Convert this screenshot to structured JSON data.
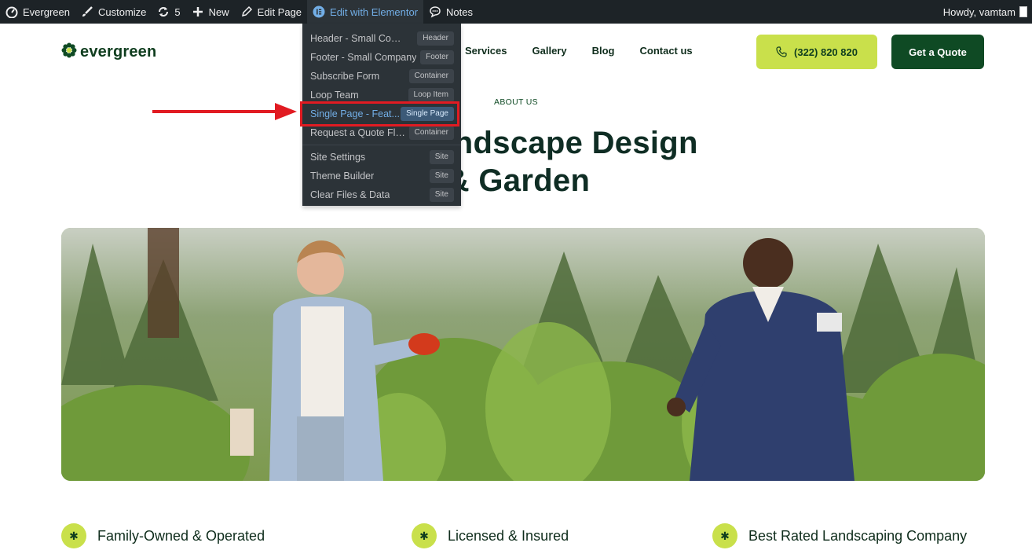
{
  "adminbar": {
    "site_name": "Evergreen",
    "customize": "Customize",
    "updates_count": "5",
    "new": "New",
    "edit_page": "Edit Page",
    "edit_with_elementor": "Edit with Elementor",
    "notes": "Notes",
    "greeting": "Howdy, vamtam"
  },
  "dropdown": {
    "items": [
      {
        "label": "Header - Small Comp...",
        "tag": "Header"
      },
      {
        "label": "Footer - Small Company",
        "tag": "Footer"
      },
      {
        "label": "Subscribe Form",
        "tag": "Container"
      },
      {
        "label": "Loop Team",
        "tag": "Loop Item"
      },
      {
        "label": "Single Page - Feat...",
        "tag": "Single Page"
      },
      {
        "label": "Request a Quote Flo...",
        "tag": "Container"
      }
    ],
    "site_items": [
      {
        "label": "Site Settings",
        "tag": "Site"
      },
      {
        "label": "Theme Builder",
        "tag": "Site"
      },
      {
        "label": "Clear Files & Data",
        "tag": "Site"
      }
    ]
  },
  "header": {
    "logo": "evergreen",
    "nav": [
      "Services",
      "Gallery",
      "Blog",
      "Contact us"
    ],
    "phone": "(322) 820 820",
    "quote": "Get a Quote"
  },
  "main": {
    "eyebrow": "ABOUT US",
    "headline_line1": "Best Landscape Design",
    "headline_line2": "& Garden"
  },
  "features": [
    {
      "icon": "asterisk-icon",
      "label": "Family-Owned & Operated"
    },
    {
      "icon": "asterisk-icon",
      "label": "Licensed & Insured"
    },
    {
      "icon": "asterisk-icon",
      "label": "Best Rated Landscaping Company"
    }
  ],
  "colors": {
    "adminbar_bg": "#1d2327",
    "brand_green": "#0f4a24",
    "accent_lime": "#c9e04b",
    "highlight_red": "#e11b22"
  }
}
